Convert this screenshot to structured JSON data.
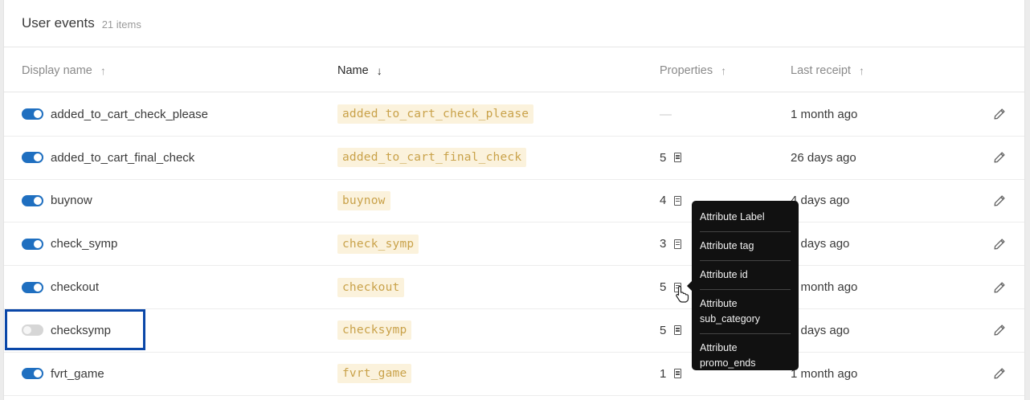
{
  "header": {
    "title": "User events",
    "count": "21 items"
  },
  "columns": {
    "display_name": "Display name",
    "name": "Name",
    "properties": "Properties",
    "last_receipt": "Last receipt",
    "up_arrow": "↑",
    "down_arrow": "↓"
  },
  "rows": [
    {
      "enabled": true,
      "display_name": "added_to_cart_check_please",
      "name": "added_to_cart_check_please",
      "properties": "—",
      "last_receipt": "1 month ago"
    },
    {
      "enabled": true,
      "display_name": "added_to_cart_final_check",
      "name": "added_to_cart_final_check",
      "properties": "5",
      "last_receipt": "26 days ago"
    },
    {
      "enabled": true,
      "display_name": "buynow",
      "name": "buynow",
      "properties": "4",
      "last_receipt": "4 days ago"
    },
    {
      "enabled": true,
      "display_name": "check_symp",
      "name": "check_symp",
      "properties": "3",
      "last_receipt": "4 days ago"
    },
    {
      "enabled": true,
      "display_name": "checkout",
      "name": "checkout",
      "properties": "5",
      "last_receipt": "1 month ago"
    },
    {
      "enabled": false,
      "display_name": "checksymp",
      "name": "checksymp",
      "properties": "5",
      "last_receipt": "9 days ago"
    },
    {
      "enabled": true,
      "display_name": "fvrt_game",
      "name": "fvrt_game",
      "properties": "1",
      "last_receipt": "1 month ago"
    }
  ],
  "tooltip": {
    "items": [
      {
        "line1": "Attribute Label",
        "line2": ""
      },
      {
        "line1": "Attribute tag",
        "line2": ""
      },
      {
        "line1": "Attribute id",
        "line2": ""
      },
      {
        "line1": "Attribute",
        "line2": "sub_category"
      },
      {
        "line1": "Attribute",
        "line2": "promo_ends"
      }
    ]
  },
  "colors": {
    "toggle_on": "#1f6fc0",
    "highlight": "#0a47a8",
    "code_text": "#c9a24a",
    "code_bg": "#fbf2dc"
  },
  "icons": {
    "properties": "document-icon",
    "edit": "pencil-icon",
    "cursor": "hand-pointer-icon"
  }
}
